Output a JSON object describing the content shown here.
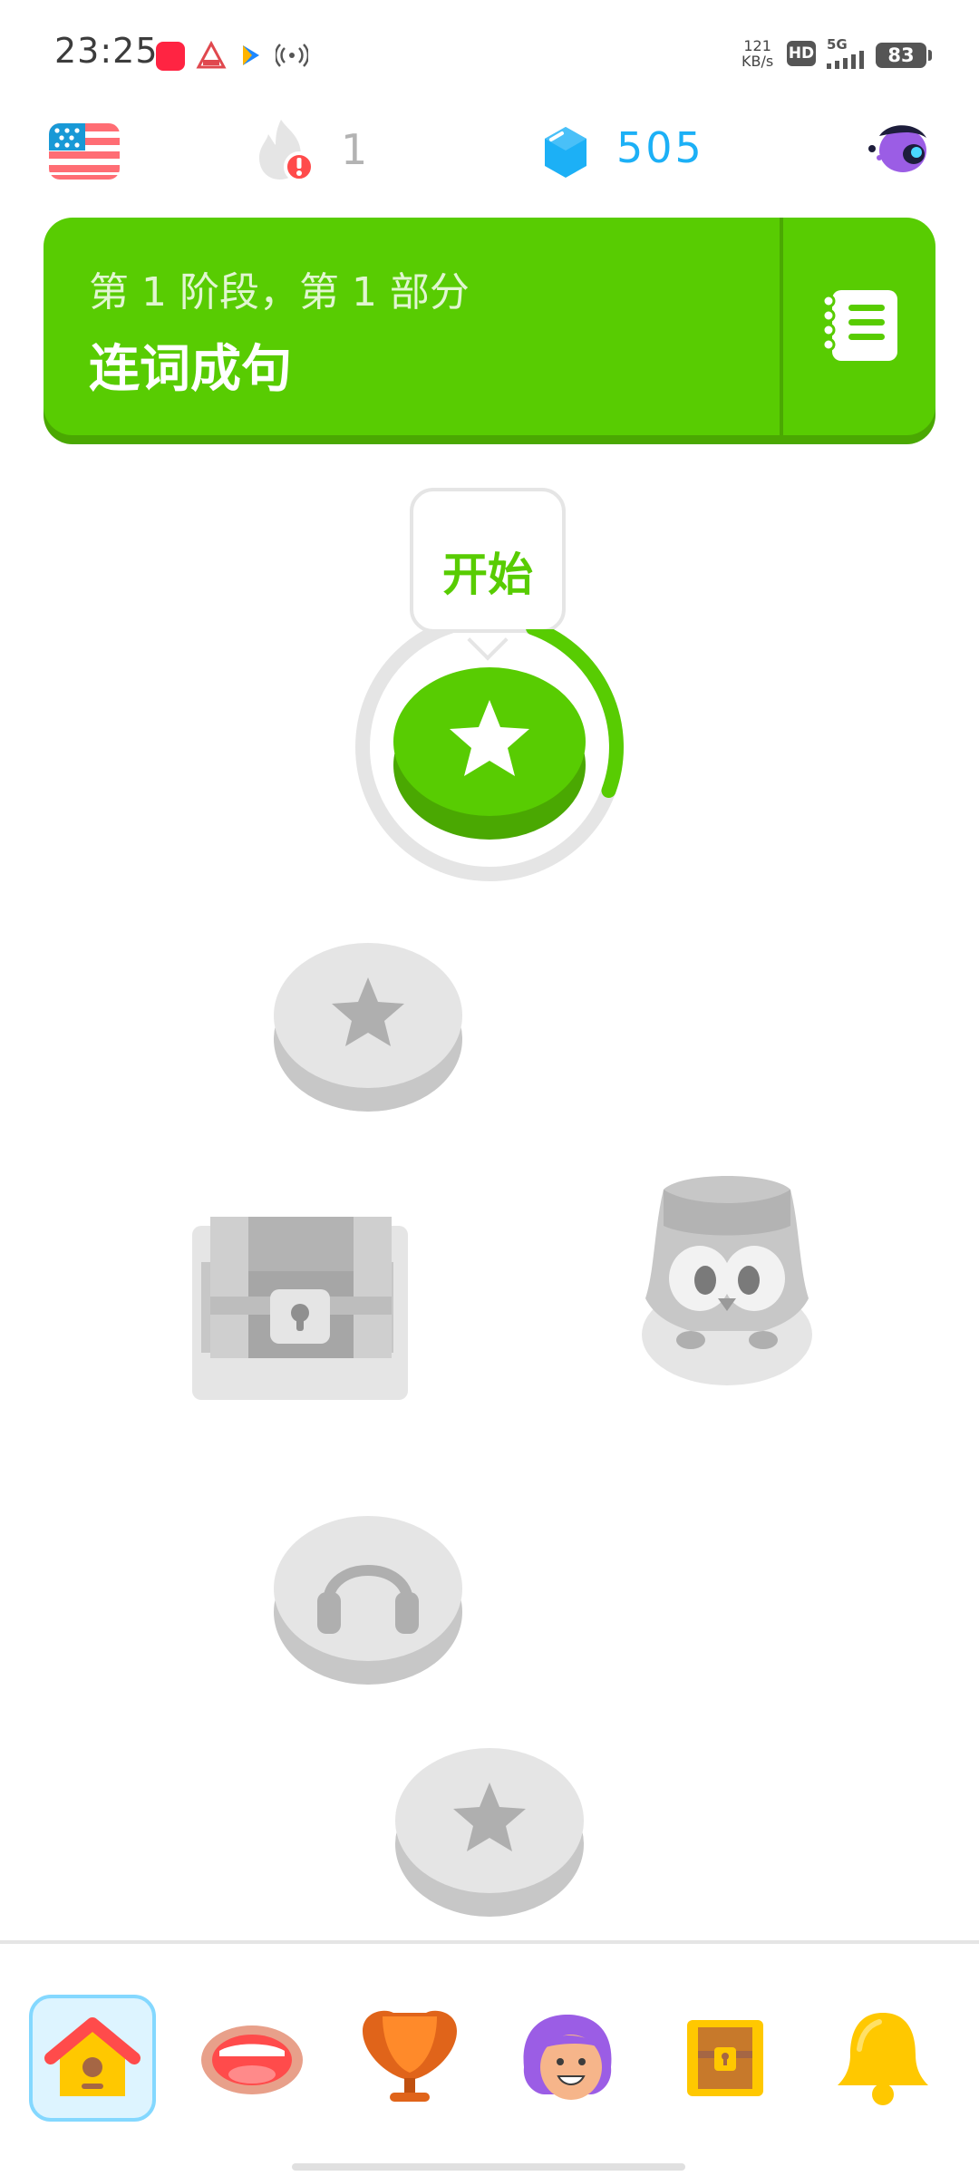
{
  "status_bar": {
    "time": "23:25",
    "net_speed_value": "121",
    "net_speed_unit": "KB/s",
    "hd_label": "HD",
    "network_label": "5G",
    "battery_level": "83"
  },
  "stats": {
    "streak_count": "1",
    "gem_count": "505"
  },
  "unit": {
    "subtitle": "第 1 阶段，第 1 部分",
    "title": "连词成句"
  },
  "path": {
    "start_label": "开始",
    "current_progress": 0.25
  },
  "colors": {
    "green": "#58cc02",
    "green_dark": "#4aa802",
    "blue": "#1cb0f6",
    "locked": "#e5e5e5",
    "locked_dark": "#c7c7c7"
  },
  "icons": {
    "flag": "us-flag-icon",
    "streak": "flame-icon",
    "gems": "gem-icon",
    "guidebook": "guidebook-icon"
  }
}
